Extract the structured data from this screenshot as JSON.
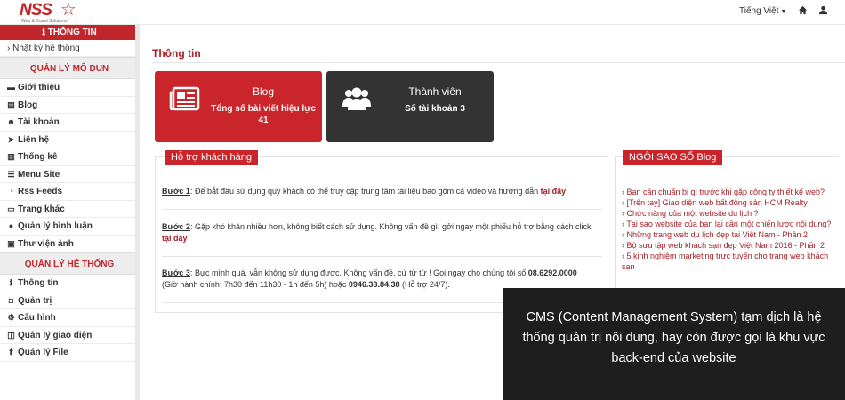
{
  "topbar": {
    "logo_text": "NSS",
    "logo_sub": "Web & Brand Solutions",
    "language": "Tiếng Việt"
  },
  "sidebar": {
    "top_label": "ℹ THÔNG TIN",
    "log_link": "› Nhật ký hệ thống",
    "module_section": "QUẢN LÝ MÔ ĐUN",
    "modules": [
      {
        "label": "Giới thiệu",
        "icon": "laptop-icon"
      },
      {
        "label": "Blog",
        "icon": "newspaper-icon"
      },
      {
        "label": "Tài khoản",
        "icon": "users-icon"
      },
      {
        "label": "Liên hệ",
        "icon": "send-icon"
      },
      {
        "label": "Thống kê",
        "icon": "bar-chart-icon"
      },
      {
        "label": "Menu Site",
        "icon": "list-icon"
      },
      {
        "label": "Rss Feeds",
        "icon": "rss-icon"
      },
      {
        "label": "Trang khác",
        "icon": "window-icon"
      },
      {
        "label": "Quản lý bình luận",
        "icon": "comment-icon"
      },
      {
        "label": "Thư viện ảnh",
        "icon": "image-icon"
      }
    ],
    "system_section": "QUẢN LÝ HỆ THỐNG",
    "system": [
      {
        "label": "Thông tin",
        "icon": "info-icon"
      },
      {
        "label": "Quản trị",
        "icon": "lock-icon"
      },
      {
        "label": "Cấu hình",
        "icon": "cogs-icon"
      },
      {
        "label": "Quản lý giao diện",
        "icon": "layout-icon"
      },
      {
        "label": "Quản lý File",
        "icon": "upload-icon"
      }
    ]
  },
  "main": {
    "page_title": "Thông tin",
    "cards": [
      {
        "title": "Blog",
        "sub1": "Tổng số bài viết hiệu lực",
        "sub2": "41",
        "icon": "newspaper-icon",
        "color": "#c9252b"
      },
      {
        "title": "Thành viên",
        "sub1": "Số tài khoản 3",
        "sub2": "",
        "icon": "users-icon",
        "color": "#333333"
      }
    ],
    "support": {
      "tag": "Hỗ trợ khách hàng",
      "step1_label": "Bước 1",
      "step1_text": ": Để bắt đầu sử dụng quý khách có thể truy cập trung tâm tài liệu bao gồm cả video và hướng dẫn",
      "step1_link": "tại đây",
      "step2_label": "Bước 2",
      "step2_text": ": Gặp khó khăn nhiều hơn, không biết cách sử dụng. Không vấn đề gì, gởi ngay một phiếu hỗ trợ bằng cách click",
      "step2_link": "tại đây",
      "step3_label": "Bước 3",
      "step3_text": ": Bực mình quá, vẫn không sử dụng được. Không vấn đề, cứ từ từ ! Gọi ngay cho chúng tôi số",
      "step3_phone": "08.6292.0000",
      "step3_hours": "(Giờ hành chính: 7h30 đến 11h30 - 1h đến 5h) hoặc",
      "step3_hotline": "0946.38.84.38",
      "step3_tail": "(Hỗ trợ 24/7)."
    },
    "blog_panel": {
      "tag": "NGÔI SAO SỐ Blog",
      "posts": [
        "› Bạn cần chuẩn bị gì trước khi gặp công ty thiết kế web?",
        "› [Trên tay] Giao diện web bất động sản HCM Realty",
        "› Chức năng của một website du lịch ?",
        "› Tại sao website của bạn lại cần một chiến lược nội dung?",
        "› Những trang web du lịch đẹp tại Việt Nam - Phần 2",
        "› Bộ sưu tập web khách sạn đẹp Việt Nam 2016 - Phần 2",
        "› 5 kinh nghiệm marketing trực tuyến cho trang web khách sạn"
      ]
    }
  },
  "overlay": {
    "text": "CMS (Content Management System) tạm dịch là hệ thống quản trị nội dung, hay còn được gọi là khu vực back-end của website"
  }
}
